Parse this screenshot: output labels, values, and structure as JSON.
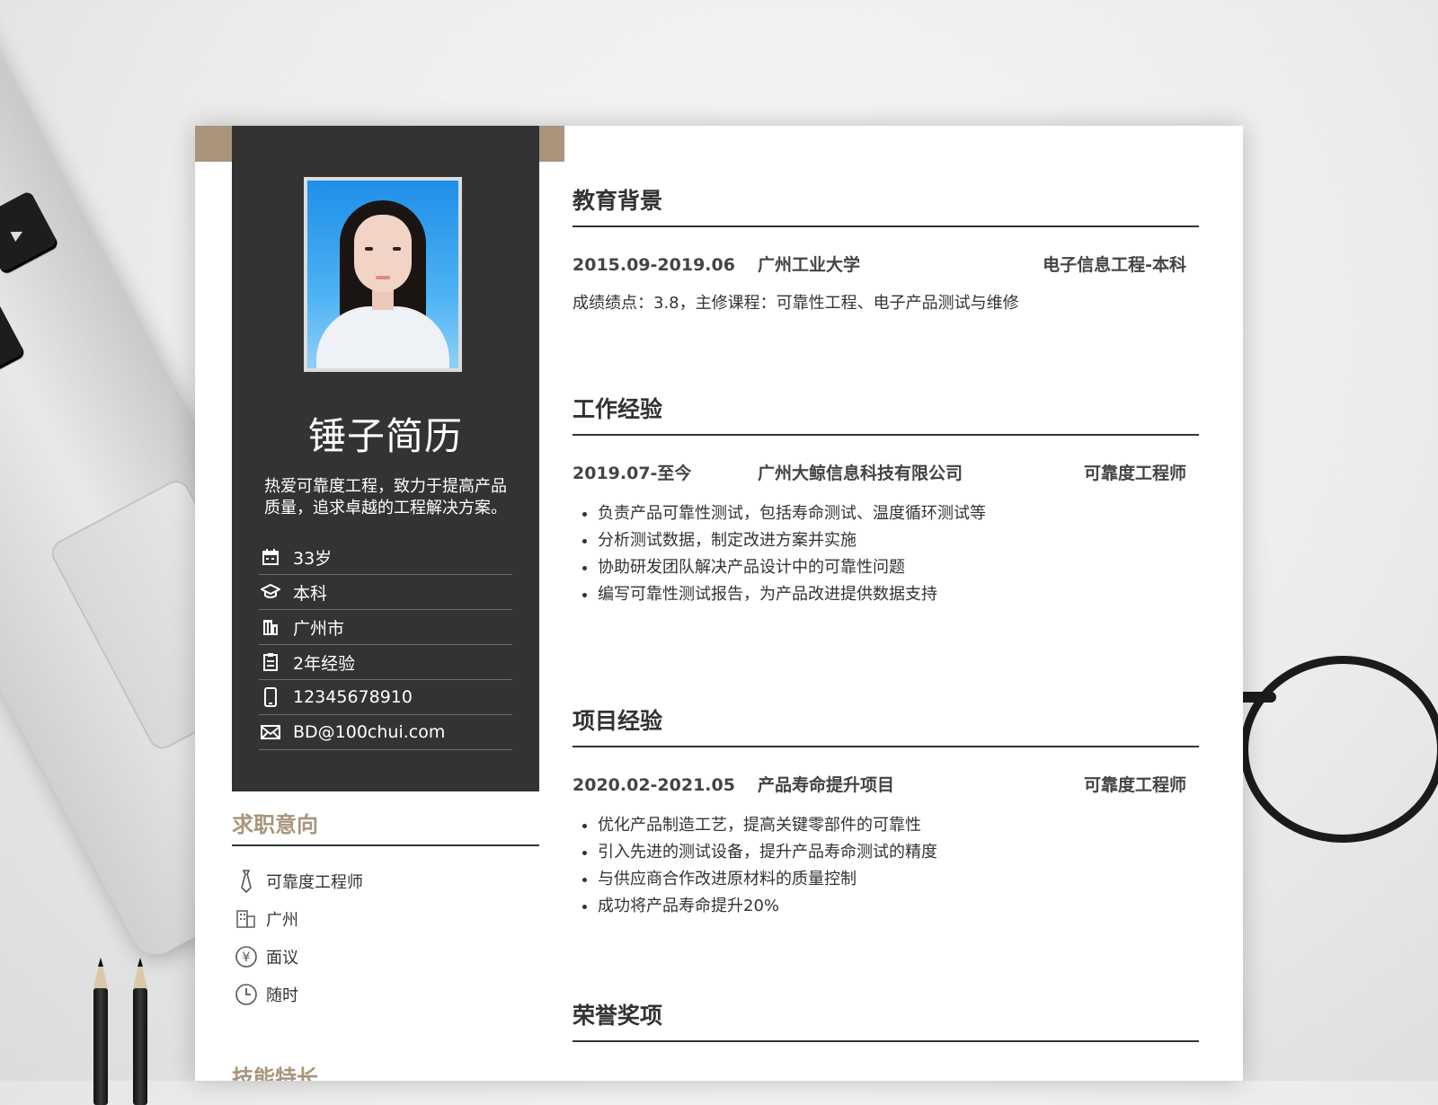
{
  "profile": {
    "name": "锤子简历",
    "motto": "热爱可靠度工程，致力于提高产品质量，追求卓越的工程解决方案。",
    "info": [
      {
        "icon": "calendar-icon",
        "text": "33岁"
      },
      {
        "icon": "graduation-cap-icon",
        "text": "本科"
      },
      {
        "icon": "building-icon",
        "text": "广州市"
      },
      {
        "icon": "clipboard-icon",
        "text": "2年经验"
      },
      {
        "icon": "phone-icon",
        "text": "12345678910"
      },
      {
        "icon": "envelope-icon",
        "text": "BD@100chui.com"
      }
    ]
  },
  "intent": {
    "title": "求职意向",
    "items": [
      {
        "icon": "tie-icon",
        "text": "可靠度工程师"
      },
      {
        "icon": "office-building-icon",
        "text": "广州"
      },
      {
        "icon": "yuan-coin-icon",
        "text": "面议"
      },
      {
        "icon": "clock-icon",
        "text": "随时"
      }
    ]
  },
  "skills": {
    "title": "技能特长"
  },
  "education": {
    "title": "教育背景",
    "date": "2015.09-2019.06",
    "school": "广州工业大学",
    "major": "电子信息工程-本科",
    "desc": "成绩绩点：3.8，主修课程：可靠性工程、电子产品测试与维修"
  },
  "work": {
    "title": "工作经验",
    "date": "2019.07-至今",
    "company": "广州大鲸信息科技有限公司",
    "role": "可靠度工程师",
    "bullets": [
      "负责产品可靠性测试，包括寿命测试、温度循环测试等",
      "分析测试数据，制定改进方案并实施",
      "协助研发团队解决产品设计中的可靠性问题",
      "编写可靠性测试报告，为产品改进提供数据支持"
    ]
  },
  "project": {
    "title": "项目经验",
    "date": "2020.02-2021.05",
    "name": "产品寿命提升项目",
    "role": "可靠度工程师",
    "bullets": [
      "优化产品制造工艺，提高关键零部件的可靠性",
      "引入先进的测试设备，提升产品寿命测试的精度",
      "与供应商合作改进原材料的质量控制",
      "成功将产品寿命提升20%"
    ]
  },
  "honors": {
    "title": "荣誉奖项"
  },
  "colors": {
    "accent": "#a8957b",
    "panel": "#333333"
  }
}
